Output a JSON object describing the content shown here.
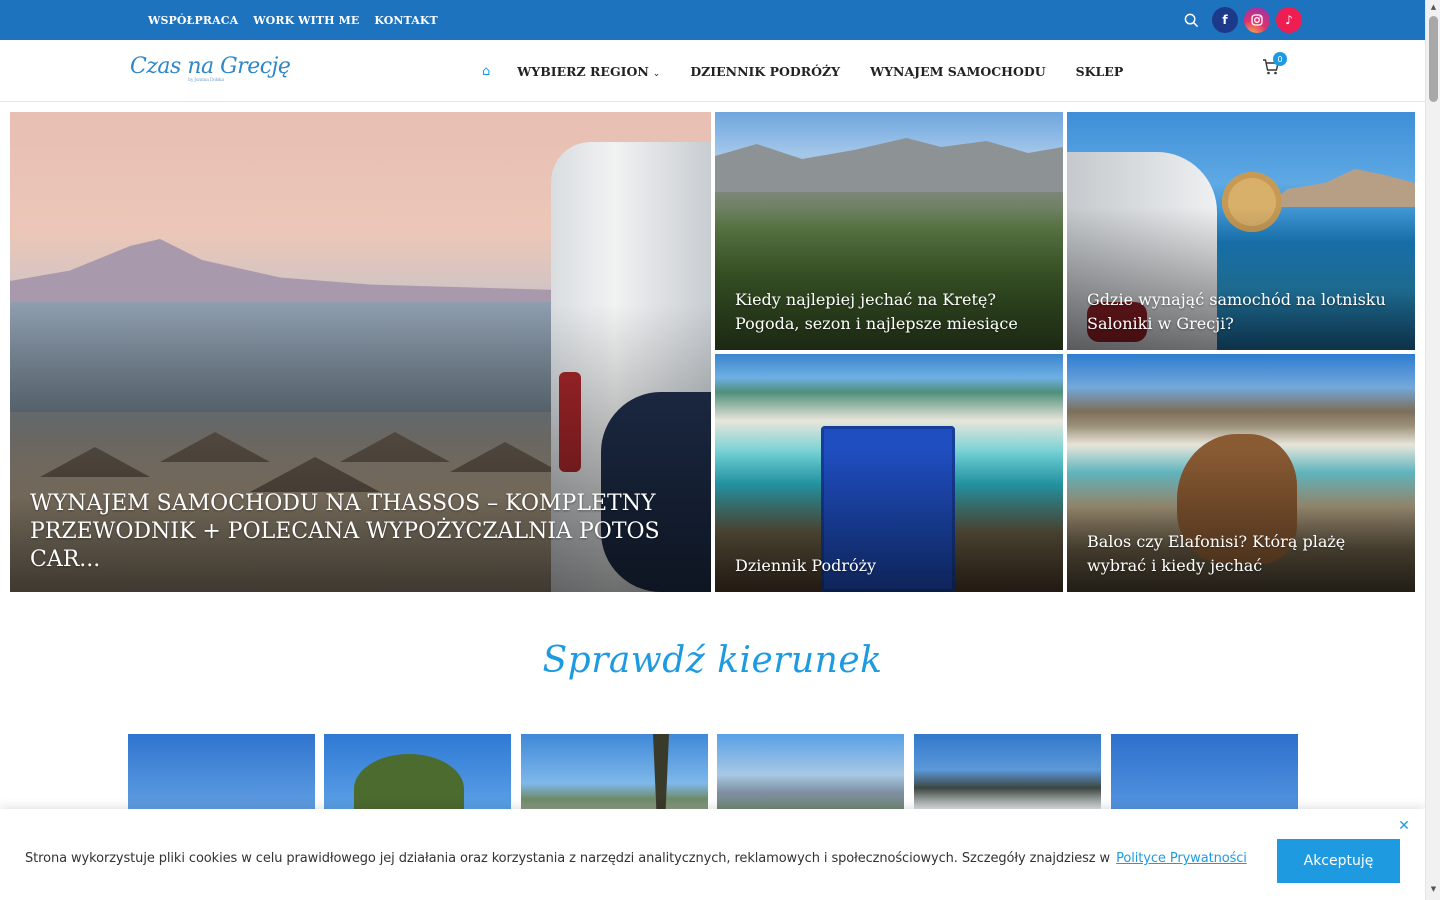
{
  "topbar": {
    "links": [
      "WSPÓŁPRACA",
      "WORK WITH ME",
      "KONTAKT"
    ],
    "social": {
      "facebook": "f",
      "instagram": "ig",
      "tiktok": "♪"
    }
  },
  "header": {
    "logo": "Czas na Grecję",
    "logo_sub": "by Joanna Dolska",
    "home_icon": "⌂",
    "nav": [
      "WYBIERZ REGION",
      "DZIENNIK PODRÓŻY",
      "WYNAJEM SAMOCHODU",
      "SKLEP"
    ],
    "cart_count": "0"
  },
  "hero": {
    "main": "WYNAJEM SAMOCHODU NA THASSOS – KOMPLETNY PRZEWODNIK + POLECANA WYPOŻYCZALNIA POTOS CAR...",
    "tiles": [
      "Kiedy najlepiej jechać na Kretę? Pogoda, sezon i najlepsze miesiące",
      "Gdzie wynająć samochód na lotnisku Saloniki w Grecji?",
      "Dziennik Podróży",
      "Balos czy Elafonisi? Którą plażę wybrać i kiedy jechać"
    ]
  },
  "section": {
    "title": "Sprawdź kierunek"
  },
  "cookie": {
    "text": "Strona wykorzystuje pliki cookies w celu prawidłowego jej działania oraz korzystania z narzędzi analitycznych, reklamowych i społecznościowych. Szczegóły znajdziesz w",
    "link": "Polityce Prywatności",
    "accept": "Akceptuję",
    "close": "✕"
  },
  "colors": {
    "brand": "#1e73be",
    "accent": "#1e9be0"
  }
}
